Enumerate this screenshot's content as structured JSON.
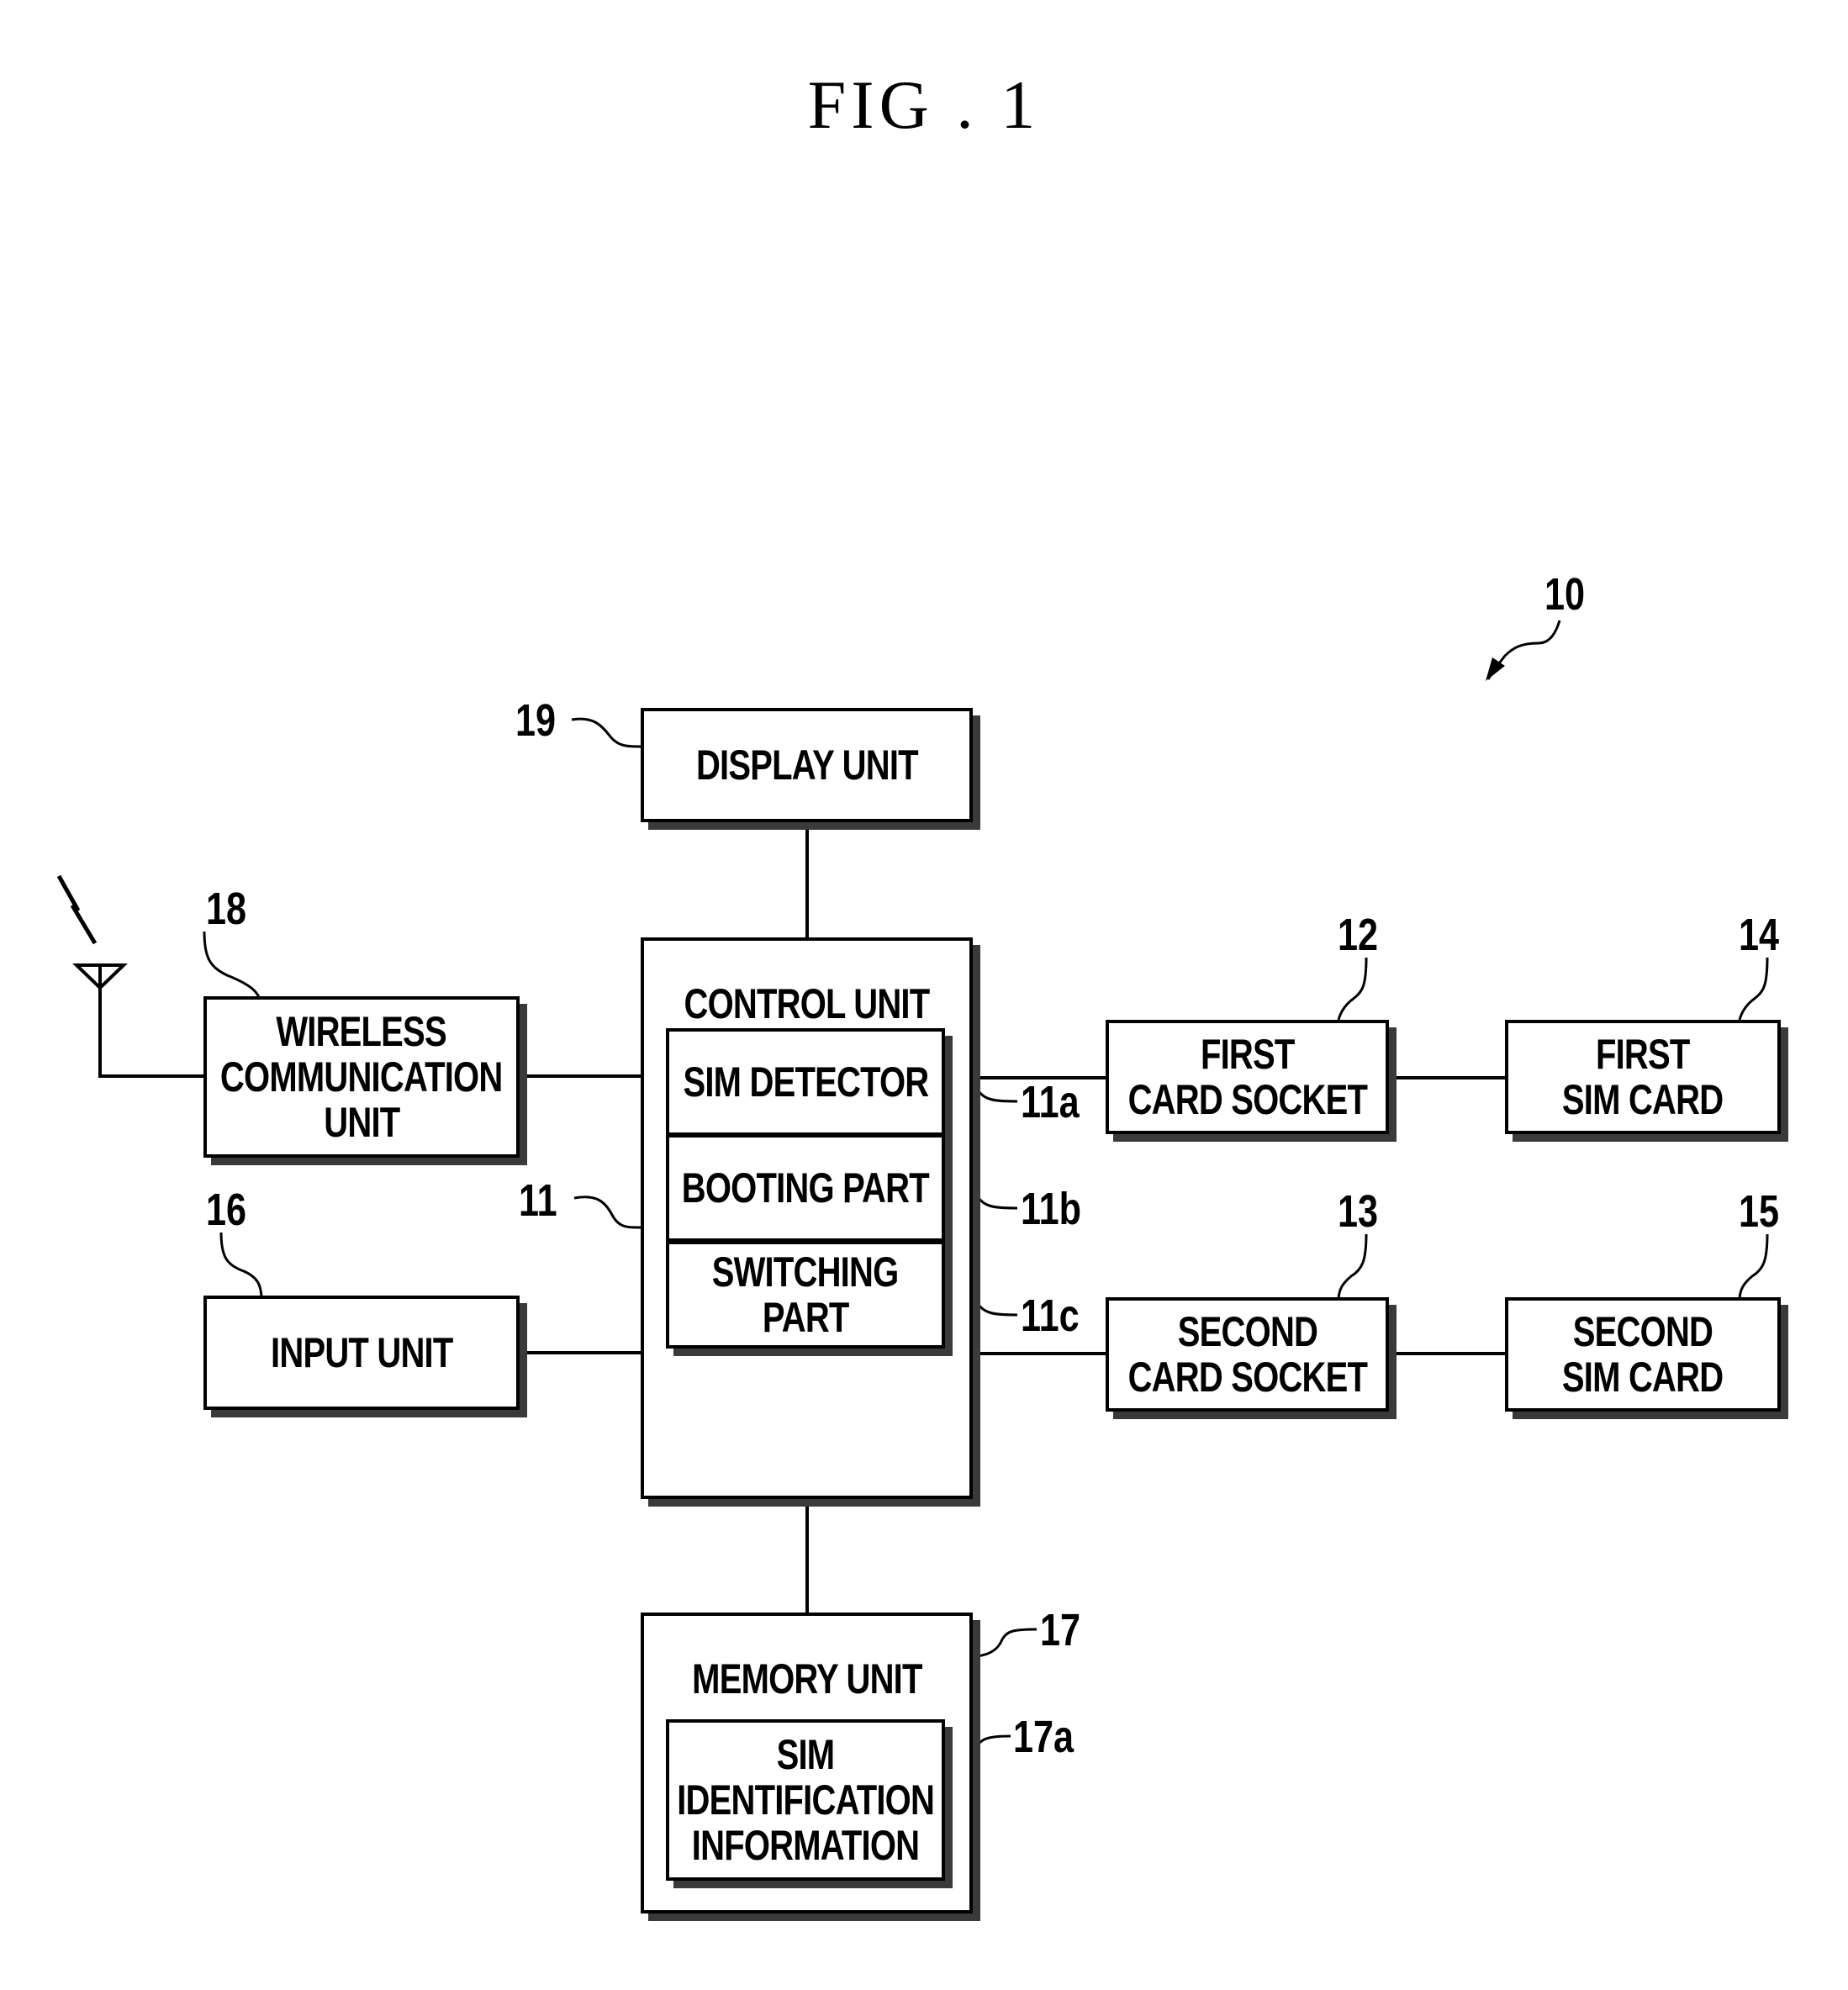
{
  "figure": {
    "title": "FIG . 1",
    "device_ref": "10"
  },
  "blocks": {
    "display_unit": {
      "label": "DISPLAY UNIT",
      "ref": "19"
    },
    "wireless_unit": {
      "label": [
        "WIRELESS",
        "COMMUNICATION",
        "UNIT"
      ],
      "ref": "18"
    },
    "input_unit": {
      "label": "INPUT UNIT",
      "ref": "16"
    },
    "control_unit": {
      "label": "CONTROL UNIT",
      "ref": "11",
      "parts": [
        {
          "label": [
            "SIM DETECTOR"
          ],
          "ref": "11a"
        },
        {
          "label": [
            "BOOTING PART"
          ],
          "ref": "11b"
        },
        {
          "label": [
            "SWITCHING",
            "PART"
          ],
          "ref": "11c"
        }
      ]
    },
    "memory_unit": {
      "label": "MEMORY UNIT",
      "ref": "17",
      "parts": [
        {
          "label": [
            "SIM",
            "IDENTIFICATION",
            "INFORMATION"
          ],
          "ref": "17a"
        }
      ]
    },
    "first_card_socket": {
      "label": [
        "FIRST",
        "CARD SOCKET"
      ],
      "ref": "12"
    },
    "second_card_socket": {
      "label": [
        "SECOND",
        "CARD SOCKET"
      ],
      "ref": "13"
    },
    "first_sim_card": {
      "label": [
        "FIRST",
        "SIM CARD"
      ],
      "ref": "14"
    },
    "second_sim_card": {
      "label": [
        "SECOND",
        "SIM CARD"
      ],
      "ref": "15"
    }
  },
  "icons": {
    "antenna": "antenna-icon",
    "signal": "lightning-signal-icon",
    "arrow": "curved-arrow-icon"
  }
}
